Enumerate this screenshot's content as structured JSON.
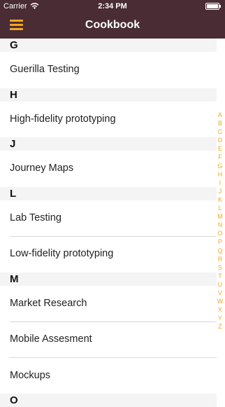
{
  "status": {
    "carrier": "Carrier",
    "time": "2:34 PM"
  },
  "navbar": {
    "title": "Cookbook",
    "menu_icon": "hamburger-menu-icon"
  },
  "sections": [
    {
      "letter": "G",
      "items": [
        "Guerilla Testing"
      ]
    },
    {
      "letter": "H",
      "items": [
        "High-fidelity prototyping"
      ]
    },
    {
      "letter": "J",
      "items": [
        "Journey Maps"
      ]
    },
    {
      "letter": "L",
      "items": [
        "Lab Testing",
        "Low-fidelity prototyping"
      ]
    },
    {
      "letter": "M",
      "items": [
        "Market Research",
        "Mobile Assesment",
        "Mockups"
      ]
    },
    {
      "letter": "O",
      "items": []
    }
  ],
  "index_letters": [
    "A",
    "B",
    "C",
    "D",
    "E",
    "F",
    "G",
    "H",
    "I",
    "J",
    "K",
    "L",
    "M",
    "N",
    "O",
    "P",
    "Q",
    "R",
    "S",
    "T",
    "U",
    "V",
    "W",
    "X",
    "Y",
    "Z"
  ],
  "colors": {
    "bar": "#4a2c35",
    "accent": "#f5a623",
    "header_bg": "#f4f4f4"
  }
}
